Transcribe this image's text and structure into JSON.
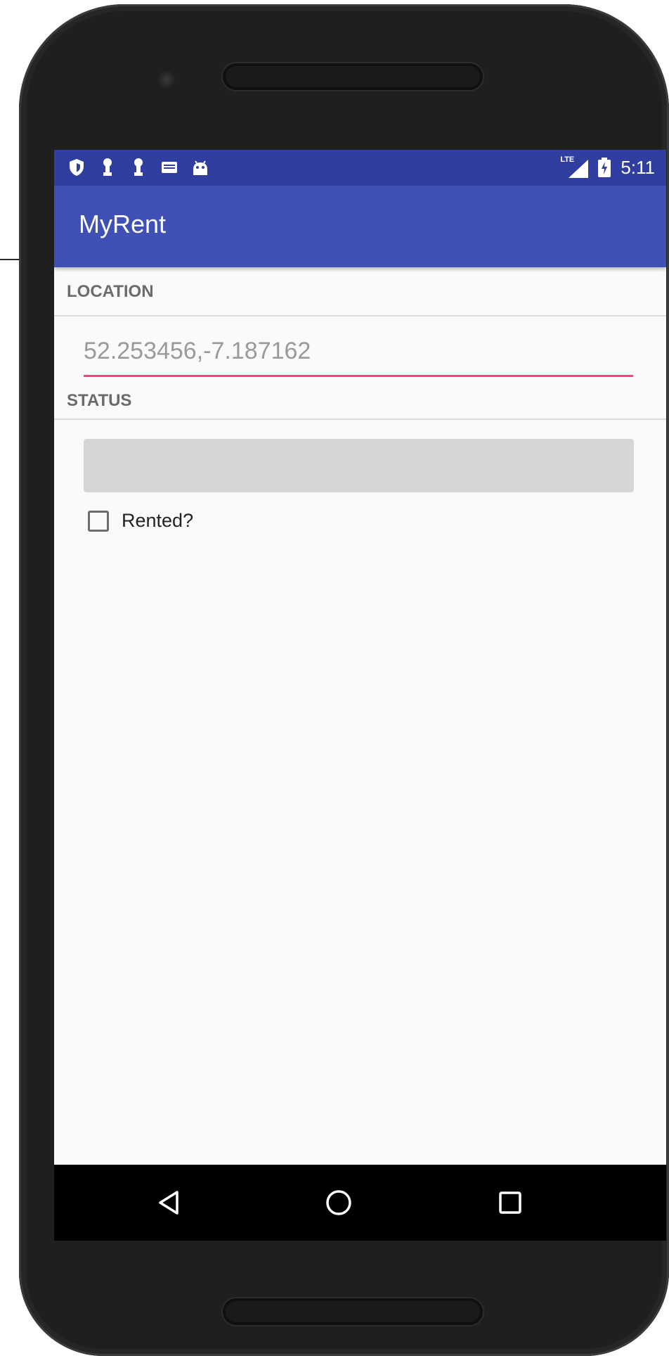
{
  "app": {
    "title": "MyRent"
  },
  "status_bar": {
    "left_icons": [
      "shield-icon",
      "key-icon",
      "key-icon",
      "mail-icon",
      "android-icon"
    ],
    "network_label": "LTE",
    "time": "5:11",
    "background_color": "#303f9f"
  },
  "app_bar": {
    "background_color": "#3f51b5"
  },
  "sections": {
    "location_header": "LOCATION",
    "status_header": "STATUS"
  },
  "location_field": {
    "value": "52.253456,-7.187162",
    "accent_color": "#ff4081"
  },
  "status_field": {
    "value": ""
  },
  "rented_checkbox": {
    "label": "Rented?",
    "checked": false
  },
  "nav_bar": {
    "buttons": [
      "back-icon",
      "home-icon",
      "recents-icon"
    ]
  }
}
